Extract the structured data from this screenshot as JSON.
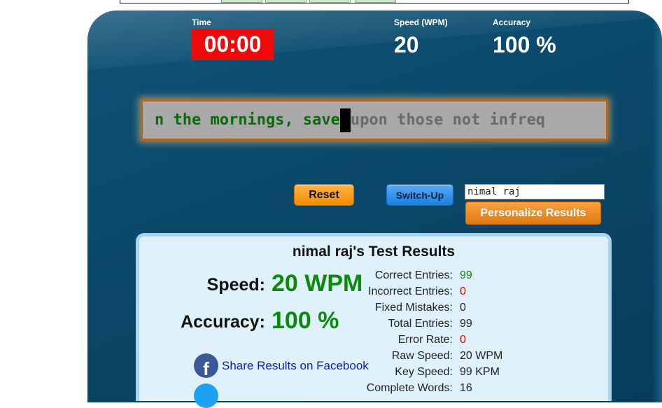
{
  "header": {
    "time_label": "Time",
    "time_value": "00:00",
    "speed_label": "Speed (WPM)",
    "speed_value": "20",
    "accuracy_label": "Accuracy",
    "accuracy_value": "100 %"
  },
  "typing": {
    "typed_text": "n the mornings, save",
    "untyped_text": "upon those not infreq"
  },
  "controls": {
    "reset_label": "Reset",
    "switch_label": "Switch-Up",
    "name_value": "nimal raj",
    "personalize_label": "Personalize Results"
  },
  "results": {
    "title": "nimal raj's Test Results",
    "speed_label": "Speed:",
    "speed_value": "20 WPM",
    "accuracy_label": "Accuracy:",
    "accuracy_value": "100 %",
    "share_facebook": "Share Results on Facebook",
    "stats": [
      {
        "label": "Correct Entries:",
        "value": "99",
        "color": "green"
      },
      {
        "label": "Incorrect Entries:",
        "value": "0",
        "color": "red"
      },
      {
        "label": "Fixed Mistakes:",
        "value": "0",
        "color": "normal"
      },
      {
        "label": "Total Entries:",
        "value": "99",
        "color": "normal"
      },
      {
        "label": "Error Rate:",
        "value": "0",
        "color": "red"
      },
      {
        "label": "Raw Speed:",
        "value": "20 WPM",
        "color": "normal"
      },
      {
        "label": "Key Speed:",
        "value": "99 KPM",
        "color": "normal"
      },
      {
        "label": "Complete Words:",
        "value": "16",
        "color": "normal"
      }
    ]
  },
  "icons": {
    "facebook": "facebook-icon",
    "twitter": "twitter-icon"
  },
  "colors": {
    "timer_bg": "#ee0a0a",
    "good": "#0a8a0a",
    "bad": "#e00000"
  }
}
